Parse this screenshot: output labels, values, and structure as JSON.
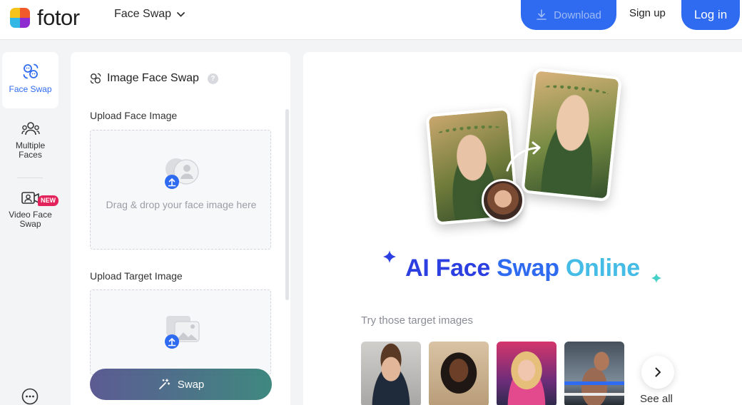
{
  "header": {
    "logo_text": "fotor",
    "tool_menu_label": "Face Swap",
    "download_label": "Download",
    "signup_label": "Sign up",
    "login_label": "Log in"
  },
  "rail": {
    "items": [
      {
        "label": "Face Swap",
        "icon": "face-swap-icon",
        "active": true
      },
      {
        "label": "Multiple Faces",
        "icon": "multiple-faces-icon",
        "active": false
      },
      {
        "label": "Video Face Swap",
        "icon": "video-face-swap-icon",
        "active": false,
        "badge": "NEW"
      }
    ],
    "more_icon": "more-icon"
  },
  "panel": {
    "title": "Image Face Swap",
    "help_glyph": "?",
    "upload_face_label": "Upload Face Image",
    "upload_face_hint": "Drag & drop your face image here",
    "upload_target_label": "Upload Target Image",
    "swap_label": "Swap"
  },
  "main": {
    "headline_part1": "AI Face ",
    "headline_part2": "Swap ",
    "headline_part3": "Online",
    "try_label": "Try those target images",
    "see_all_label": "See all"
  },
  "colors": {
    "accent": "#2f6bf0",
    "badge": "#e3245c",
    "headline_dark": "#2c3fe0",
    "headline_light": "#45bce6"
  }
}
